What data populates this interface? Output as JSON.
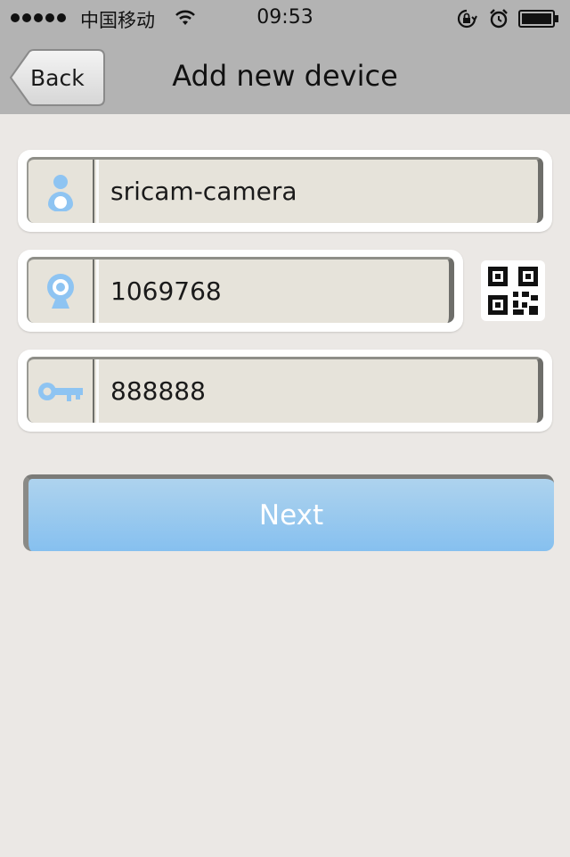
{
  "status_bar": {
    "carrier": "中国移动",
    "time": "09:53",
    "icons": [
      "signal-dots",
      "wifi-icon",
      "rotation-lock-icon",
      "alarm-icon",
      "battery-icon"
    ]
  },
  "nav": {
    "back_label": "Back",
    "title": "Add new device"
  },
  "fields": {
    "device_name": {
      "value": "sricam-camera",
      "icon": "user-icon"
    },
    "device_id": {
      "value": "1069768",
      "icon": "webcam-icon"
    },
    "password": {
      "value": "888888",
      "icon": "key-icon"
    }
  },
  "qr_icon": "qr-code-icon",
  "next_label": "Next",
  "colors": {
    "bar": "#b3b3b3",
    "background": "#ebe8e5",
    "accent": "#86c0ef",
    "icon_blue": "#8ec4f2"
  }
}
